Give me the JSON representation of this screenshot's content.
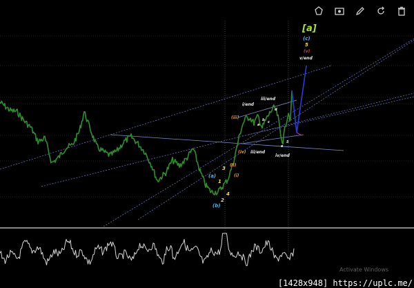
{
  "toolbar": {
    "icons": [
      "drawing-tools-icon",
      "screenshot-icon",
      "pencil-icon",
      "refresh-icon",
      "trash-icon"
    ]
  },
  "chart_data": {
    "type": "line",
    "title": "",
    "grid": true,
    "colors": {
      "price": "#2f8f2f",
      "oscillator": "#d9d9d9",
      "trendline": "#7f8fd0",
      "projection": "#2b3be0",
      "cyan": "#46b4f0",
      "yellow": "#f3e03c",
      "orange": "#e8943c",
      "red": "#e0403c",
      "white": "#f0f0f0",
      "top_bracket": "#a6e22e",
      "magenta": "#e040e0"
    },
    "wave_labels": [
      {
        "text": "[a]",
        "color": "top_bracket"
      },
      {
        "text": "(c)",
        "color": "cyan"
      },
      {
        "text": "5",
        "color": "yellow"
      },
      {
        "text": "(v)",
        "color": "red"
      },
      {
        "text": "v/end",
        "color": "white"
      },
      {
        "text": "i/end",
        "color": "white"
      },
      {
        "text": "iii/end",
        "color": "white"
      },
      {
        "text": "(iii)",
        "color": "red"
      },
      {
        "text": "(iv)",
        "color": "red"
      },
      {
        "text": "iv/end",
        "color": "white"
      },
      {
        "text": "iii/end",
        "color": "white"
      },
      {
        "text": "(ii)",
        "color": "red"
      },
      {
        "text": "(i)",
        "color": "red"
      },
      {
        "text": "(a)",
        "color": "cyan"
      },
      {
        "text": "(b)",
        "color": "cyan"
      },
      {
        "text": "1",
        "color": "yellow"
      },
      {
        "text": "2",
        "color": "yellow"
      },
      {
        "text": "3",
        "color": "yellow"
      },
      {
        "text": "4",
        "color": "yellow"
      },
      {
        "text": "a",
        "color": "white"
      },
      {
        "text": "b",
        "color": "white"
      },
      {
        "text": "c",
        "color": "white"
      },
      {
        "text": "d",
        "color": "white"
      },
      {
        "text": "e",
        "color": "white"
      },
      {
        "text": "5",
        "color": "white"
      }
    ]
  },
  "overlay": {
    "watermark": "Activate Windows",
    "caption": "[1428x948] https://uplc.me/"
  }
}
